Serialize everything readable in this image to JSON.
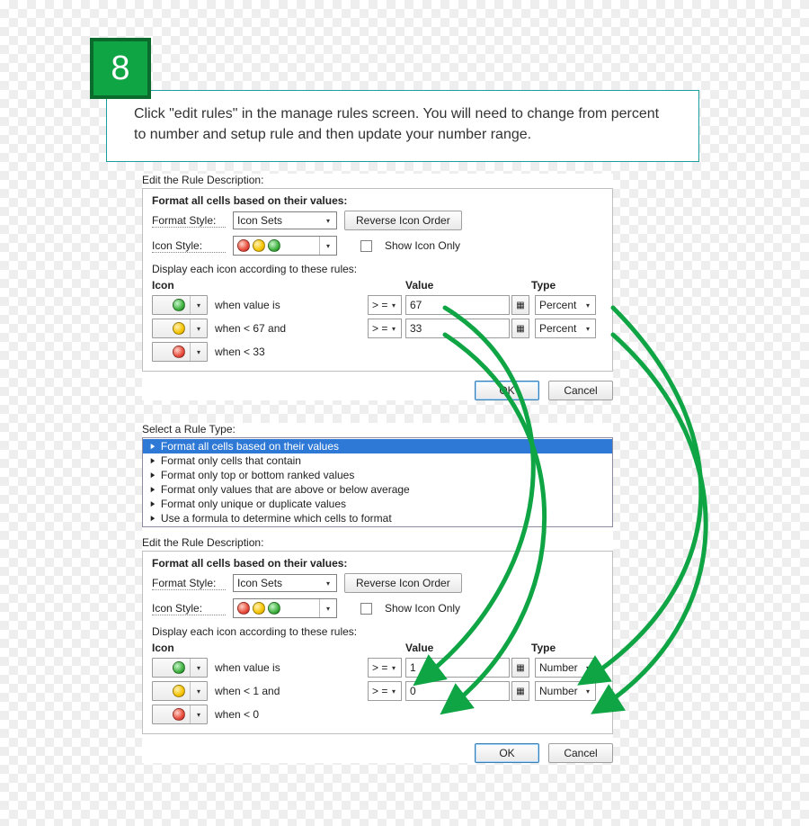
{
  "step": {
    "number": "8",
    "instruction": "Click \"edit rules\" in the manage rules screen. You will need to change from percent to number and setup rule and then update your number range."
  },
  "dialog_top": {
    "section_title": "Edit the Rule Description:",
    "heading": "Format all cells based on their values:",
    "format_style_label": "Format Style:",
    "format_style_value": "Icon Sets",
    "reverse_btn": "Reverse Icon Order",
    "icon_style_label": "Icon Style:",
    "show_icon_only": "Show Icon Only",
    "display_rule_label": "Display each icon according to these rules:",
    "headers": {
      "icon": "Icon",
      "value": "Value",
      "type": "Type"
    },
    "rows": [
      {
        "when": "when value is",
        "op": "> =",
        "value": "67",
        "type": "Percent"
      },
      {
        "when": "when < 67 and",
        "op": "> =",
        "value": "33",
        "type": "Percent"
      },
      {
        "when": "when < 33"
      }
    ],
    "ok": "OK",
    "cancel": "Cancel"
  },
  "ruletype": {
    "title": "Select a Rule Type:",
    "items": [
      "Format all cells based on their values",
      "Format only cells that contain",
      "Format only top or bottom ranked values",
      "Format only values that are above or below average",
      "Format only unique or duplicate values",
      "Use a formula to determine which cells to format"
    ]
  },
  "dialog_bottom": {
    "section_title": "Edit the Rule Description:",
    "heading": "Format all cells based on their values:",
    "format_style_label": "Format Style:",
    "format_style_value": "Icon Sets",
    "reverse_btn": "Reverse Icon Order",
    "icon_style_label": "Icon Style:",
    "show_icon_only": "Show Icon Only",
    "display_rule_label": "Display each icon according to these rules:",
    "headers": {
      "icon": "Icon",
      "value": "Value",
      "type": "Type"
    },
    "rows": [
      {
        "when": "when value is",
        "op": "> =",
        "value": "1",
        "type": "Number"
      },
      {
        "when": "when < 1 and",
        "op": "> =",
        "value": "0",
        "type": "Number"
      },
      {
        "when": "when < 0"
      }
    ],
    "ok": "OK",
    "cancel": "Cancel"
  }
}
